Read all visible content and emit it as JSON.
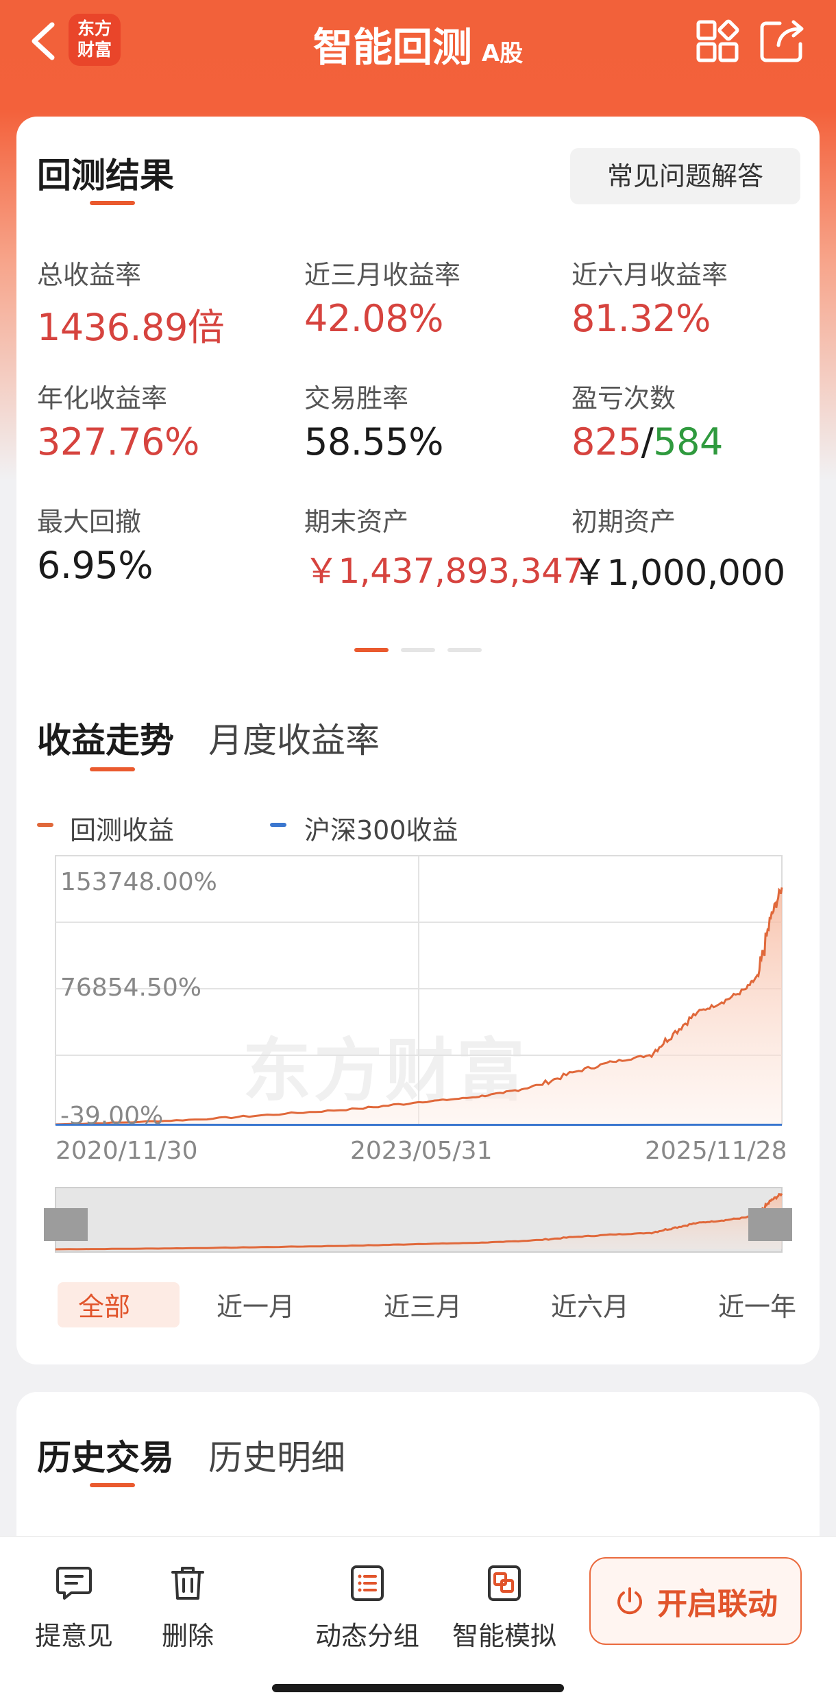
{
  "header": {
    "title": "智能回测",
    "tag": "A股",
    "logo_line1": "东方",
    "logo_line2": "财富"
  },
  "results": {
    "section_title": "回测结果",
    "faq_label": "常见问题解答",
    "metrics": [
      {
        "label": "总收益率",
        "value": "1436.89倍",
        "color": "red"
      },
      {
        "label": "近三月收益率",
        "value": "42.08%",
        "color": "red"
      },
      {
        "label": "近六月收益率",
        "value": "81.32%",
        "color": "red"
      },
      {
        "label": "年化收益率",
        "value": "327.76%",
        "color": "red"
      },
      {
        "label": "交易胜率",
        "value": "58.55%",
        "color": "dark"
      },
      {
        "label": "盈亏次数",
        "value_win": "825",
        "value_sep": "/",
        "value_loss": "584"
      },
      {
        "label": "最大回撤",
        "value": "6.95%",
        "color": "dark"
      },
      {
        "label": "期末资产",
        "value": "￥1,437,893,347",
        "color": "red"
      },
      {
        "label": "初期资产",
        "value": "￥1,000,000",
        "color": "dark"
      }
    ]
  },
  "trend": {
    "tab_active": "收益走势",
    "tab_other": "月度收益率",
    "legend_backtest": "回测收益",
    "legend_index": "沪深300收益",
    "watermark": "东方财富",
    "ranges": [
      "全部",
      "近一月",
      "近三月",
      "近六月",
      "近一年"
    ]
  },
  "chart_data": {
    "type": "area",
    "title": "",
    "xlabel": "",
    "ylabel": "",
    "y_ticks": [
      "153748.00%",
      "76854.50%",
      "-39.00%"
    ],
    "x_ticks": [
      "2020/11/30",
      "2023/05/31",
      "2025/11/28"
    ],
    "ylim": [
      -39.0,
      153748.0
    ],
    "series": [
      {
        "name": "回测收益",
        "color": "#e0683a",
        "x": [
          "2020/11/30",
          "2021/06/30",
          "2021/12/31",
          "2022/06/30",
          "2022/12/30",
          "2023/05/31",
          "2023/09/29",
          "2023/12/29",
          "2024/03/29",
          "2024/06/28",
          "2024/09/30",
          "2024/12/31",
          "2025/02/28",
          "2025/04/30",
          "2025/06/30",
          "2025/08/29",
          "2025/09/30",
          "2025/10/31",
          "2025/11/28"
        ],
        "values": [
          0,
          1500,
          3500,
          6500,
          9500,
          13500,
          16000,
          19000,
          24000,
          32000,
          38000,
          42000,
          55000,
          68000,
          74000,
          82000,
          90000,
          125000,
          143600
        ]
      },
      {
        "name": "沪深300收益",
        "color": "#3b77cf",
        "x": [
          "2020/11/30",
          "2023/05/31",
          "2025/11/28"
        ],
        "values": [
          0,
          -20,
          -10
        ]
      }
    ],
    "grid": true,
    "legend": "top-left"
  },
  "history": {
    "tab_active": "历史交易",
    "tab_other": "历史明细"
  },
  "bottombar": {
    "feedback": "提意见",
    "delete": "删除",
    "group": "动态分组",
    "simulate": "智能模拟",
    "link": "开启联动"
  }
}
